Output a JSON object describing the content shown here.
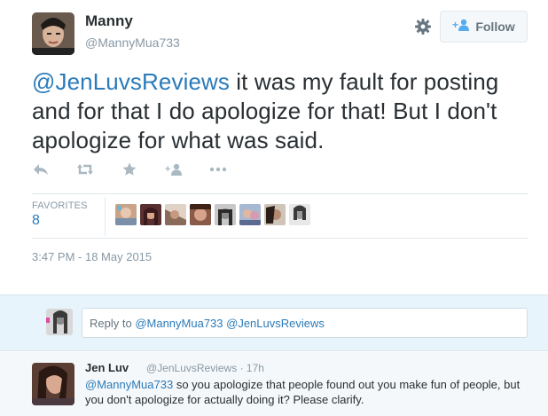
{
  "tweet": {
    "author_name": "Manny",
    "author_handle": "@MannyMua733",
    "mention": "@JenLuvsReviews",
    "text": " it was my fault for posting and for that I do apologize for that! But I don't apologize for what was said.",
    "timestamp": "3:47 PM - 18 May 2015",
    "favorites_label": "FAVORITES",
    "favorites_count": "8"
  },
  "header": {
    "follow_label": "Follow"
  },
  "actions": [
    "reply-icon",
    "retweet-icon",
    "favorite-icon",
    "follow-icon",
    "more-icon"
  ],
  "reply_composer": {
    "prefix": "Reply to ",
    "mentions": "@MannyMua733 @JenLuvsReviews"
  },
  "reply_tweet": {
    "author_name": "Jen Luv",
    "author_handle": "@JenLuvsReviews",
    "sep": "·",
    "age": "17h",
    "mention": "@MannyMua733",
    "text": " so you apologize that people found out you make fun of people, but you don't apologize for actually doing it? Please clarify."
  },
  "colors": {
    "link": "#2b7bb9",
    "muted": "#8899a6",
    "text": "#292f33",
    "reply_bg": "#e8f4fb"
  }
}
